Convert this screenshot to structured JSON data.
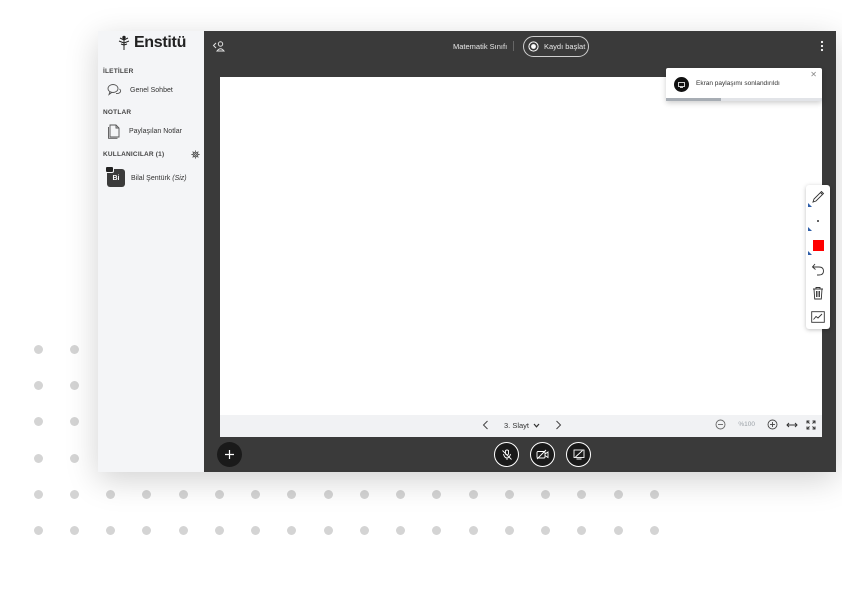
{
  "brand": {
    "name": "Enstitü",
    "icon": "tree-logo-icon"
  },
  "sidebar": {
    "messages_title": "İLETİLER",
    "public_chat": "Genel Sohbet",
    "notes_title": "NOTLAR",
    "shared_notes": "Paylaşılan Notlar",
    "users_title": "KULLANICILAR (1)",
    "users": [
      {
        "initials": "Bi",
        "name": "Bilal Şentürk",
        "you_label": "(Siz)"
      }
    ]
  },
  "topbar": {
    "meeting_title": "Matematik Sınıfı",
    "record_label": "Kaydı başlat"
  },
  "toast": {
    "message": "Ekran paylaşımı sonlandırıldı",
    "close": "✕",
    "progress": 0.35
  },
  "presentation": {
    "slide_label": "3. Slayt",
    "zoom": "%100"
  },
  "tools": [
    "pencil-icon",
    "thickness-dot-icon",
    "color-swatch",
    "undo-icon",
    "trash-icon",
    "multi-user-whiteboard-icon"
  ],
  "colors": {
    "app_bg": "#3a3a3a",
    "sidebar_bg": "#f4f5f7",
    "pen_color": "#ff0000",
    "tool_accent": "#2e5ea8"
  },
  "actions": [
    "mute-mic-icon",
    "camera-off-icon",
    "screen-share-off-icon"
  ]
}
